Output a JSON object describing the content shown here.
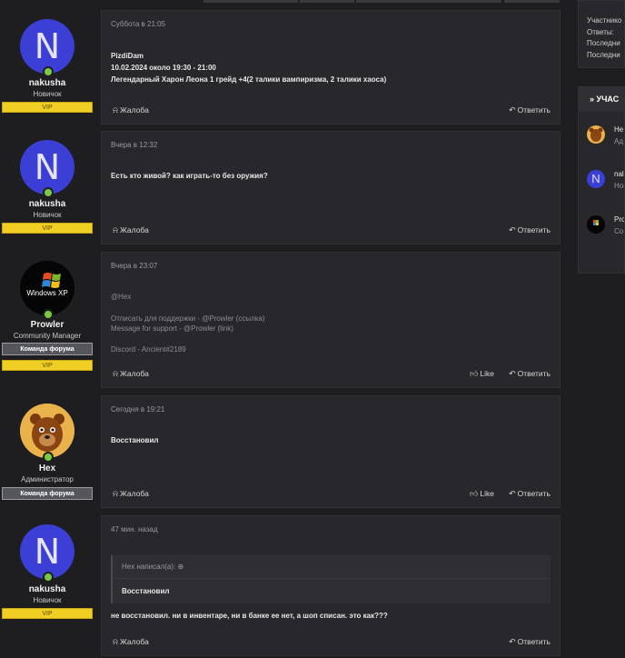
{
  "sidebar_stats": {
    "lines": [
      "Участнико",
      "Ответы:",
      "Последни",
      "Последни"
    ]
  },
  "sidebar_participants": {
    "heading": "» УЧАС",
    "items": [
      {
        "name": "He",
        "sub": "Ад"
      },
      {
        "name": "nal",
        "sub": "Нов"
      },
      {
        "name": "Pro",
        "sub": "Co"
      }
    ]
  },
  "posts": [
    {
      "user": {
        "avatar_letter": "N",
        "name": "nakusha",
        "title": "Новичок",
        "badges": [
          "VIP"
        ]
      },
      "date": "Суббота в 21:05",
      "body": [
        "PizdiDam",
        "10.02.2024 около 19:30 - 21:00",
        "Легендарный Харон Леона 1 грейд +4(2 талики вампиризма, 2 талики хаоса)"
      ],
      "actions": {
        "report": "Жалоба",
        "reply": "Ответить"
      }
    },
    {
      "user": {
        "avatar_letter": "N",
        "name": "nakusha",
        "title": "Новичок",
        "badges": [
          "VIP"
        ]
      },
      "date": "Вчера в 12:32",
      "body": [
        "Есть кто живой? как играть-то без оружия?"
      ],
      "actions": {
        "report": "Жалоба",
        "reply": "Ответить"
      }
    },
    {
      "user": {
        "avatar_text": "Windows XP",
        "name": "Prowler",
        "title": "Community Manager",
        "badges": [
          "Команда форума",
          "VIP"
        ]
      },
      "date": "Вчера в 23:07",
      "body": [
        "@Hex"
      ],
      "signature": [
        {
          "text": "Отписать для поддержки - ",
          "mention": "@Prowler",
          "suffix": " (ссылка)"
        },
        {
          "text": "Message for support - ",
          "mention": "@Prowler",
          "suffix": " (link)"
        },
        {
          "text": "Discord - Ancient#2189",
          "mention": "",
          "suffix": ""
        }
      ],
      "actions": {
        "report": "Жалоба",
        "like": "Like",
        "reply": "Ответить"
      }
    },
    {
      "user": {
        "name": "Hex",
        "title": "Администратор",
        "badges": [
          "Команда форума"
        ]
      },
      "date": "Сегодня в 19:21",
      "body": [
        "Восстановил"
      ],
      "actions": {
        "report": "Жалоба",
        "like": "Like",
        "reply": "Ответить"
      }
    },
    {
      "user": {
        "avatar_letter": "N",
        "name": "nakusha",
        "title": "Новичок",
        "badges": [
          "VIP"
        ]
      },
      "date": "47 мин. назад",
      "quote": {
        "author": "Hex написал(а):",
        "text": "Восстановил"
      },
      "body": [
        "не восстановил. ни в инвентаре, ни в банке ее нет, а шоп списан. это как???"
      ],
      "actions": {
        "report": "Жалоба",
        "reply": "Ответить"
      }
    }
  ],
  "icons": {
    "report": "bell-icon",
    "reply": "reply-icon",
    "like": "thumbs-up-icon",
    "online": "online-dot-icon"
  },
  "colors": {
    "background": "#1e1e21",
    "post_bg": "#28282c",
    "vip": "#f1ce24",
    "avatar_blue": "#3b3fd6",
    "online": "#7ac943",
    "team_badge": "#55565c"
  }
}
